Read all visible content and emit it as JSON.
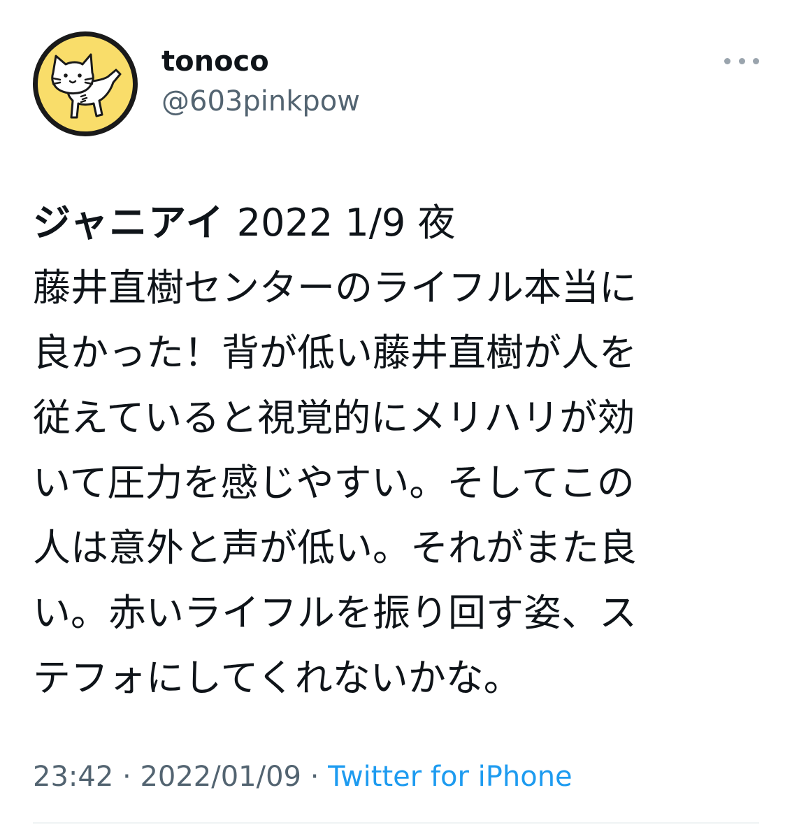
{
  "user": {
    "display_name": "tonoco",
    "handle": "@603pinkpow",
    "avatar": "cat-avatar",
    "avatar_bg": "#f9dd6a"
  },
  "more_icon": "more-dots-icon",
  "tweet": {
    "title_bold": "ジャニアイ",
    "title_rest": "2022 1/9 夜",
    "lines": [
      "藤井直樹センターのライフル本当に",
      "良かった！背が低い藤井直樹が人を",
      "従えていると視覚的にメリハリが効",
      "いて圧力を感じやすい。そしてこの",
      "人は意外と声が低い。それがまた良",
      "い。赤いライフルを振り回す姿、ス",
      "テフォにしてくれないかな。"
    ]
  },
  "meta": {
    "time": "23:42",
    "separator": "·",
    "date": "2022/01/09",
    "source": "Twitter for iPhone"
  },
  "colors": {
    "text": "#0f1419",
    "secondary": "#536471",
    "link": "#1d9bf0"
  }
}
